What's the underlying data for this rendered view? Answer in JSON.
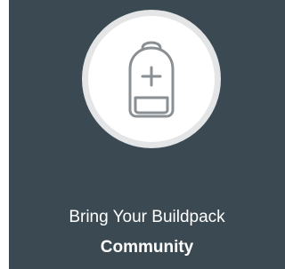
{
  "tile": {
    "title": "Bring Your Buildpack",
    "subtitle": "Community",
    "icon": "backpack-plus-icon",
    "colors": {
      "background": "#3b4a52",
      "circle": "#ffffff",
      "circle_border": "#e3e5e6",
      "icon_stroke": "#8a8f93",
      "text": "#ffffff"
    }
  }
}
